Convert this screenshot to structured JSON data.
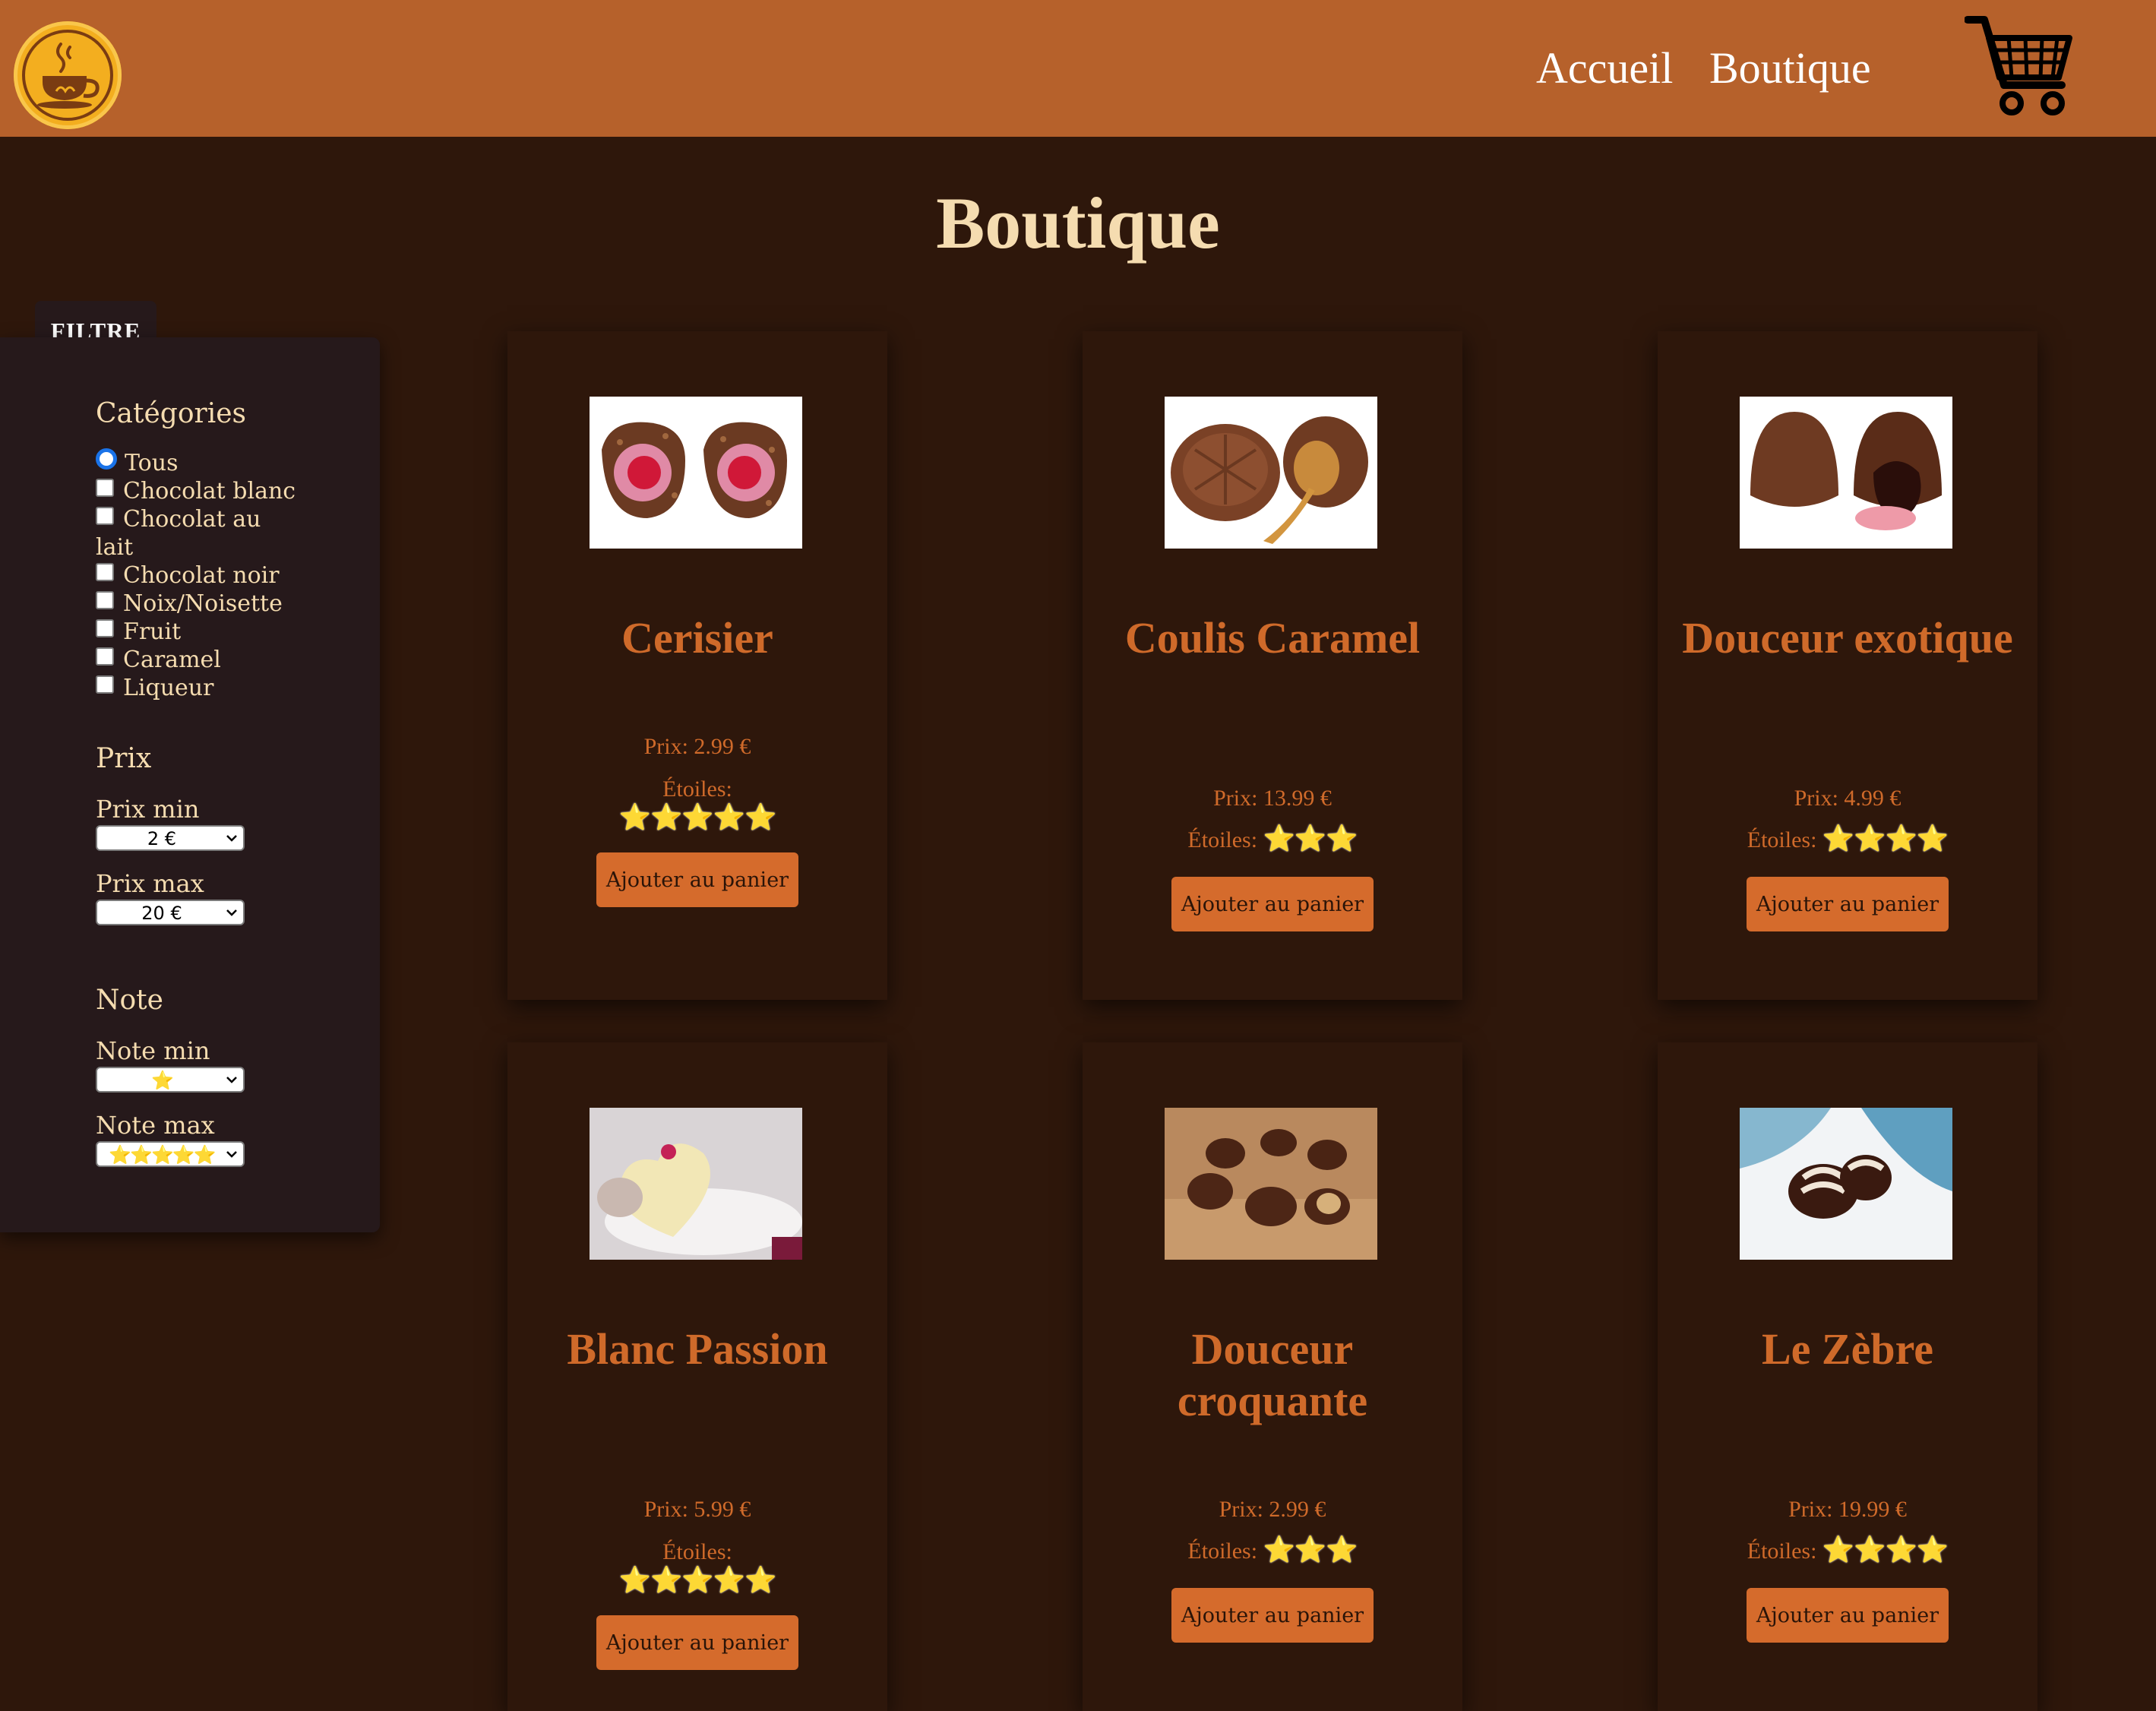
{
  "colors": {
    "header_bg": "#b6612b",
    "page_bg": "#2e170b",
    "filter_bg": "#26191b",
    "title": "#f5dcb0",
    "product_accent": "#cf6a2a",
    "button_bg": "#d56b2c",
    "star": "#f6c51d"
  },
  "header": {
    "logo_icon": "coffee-cup-logo",
    "nav": {
      "home": "Accueil",
      "shop": "Boutique"
    },
    "cart_icon": "shopping-cart-icon"
  },
  "page": {
    "title": "Boutique"
  },
  "filter": {
    "tab_label": "FILTRE",
    "categories": {
      "heading": "Catégories",
      "items": [
        {
          "label": "Tous",
          "type": "radio",
          "checked": true
        },
        {
          "label": "Chocolat blanc",
          "type": "checkbox",
          "checked": false
        },
        {
          "label": "Chocolat au lait",
          "type": "checkbox",
          "checked": false
        },
        {
          "label": "Chocolat noir",
          "type": "checkbox",
          "checked": false
        },
        {
          "label": "Noix/Noisette",
          "type": "checkbox",
          "checked": false
        },
        {
          "label": "Fruit",
          "type": "checkbox",
          "checked": false
        },
        {
          "label": "Caramel",
          "type": "checkbox",
          "checked": false
        },
        {
          "label": "Liqueur",
          "type": "checkbox",
          "checked": false
        }
      ]
    },
    "price": {
      "heading": "Prix",
      "min_label": "Prix min",
      "min_value": "2 €",
      "max_label": "Prix max",
      "max_value": "20 €"
    },
    "rating": {
      "heading": "Note",
      "min_label": "Note min",
      "min_value": "⭐",
      "max_label": "Note max",
      "max_value": "⭐⭐⭐⭐⭐"
    }
  },
  "products": [
    {
      "name": "Cerisier",
      "price": "Prix: 2.99 €",
      "stars_label": "Étoiles:",
      "stars": "⭐⭐⭐⭐⭐",
      "rating": 5,
      "button": "Ajouter au panier",
      "image_icon": "cherry-chocolate-image"
    },
    {
      "name": "Coulis Caramel",
      "price": "Prix: 13.99 €",
      "stars_label": "Étoiles:",
      "stars": "⭐⭐⭐",
      "rating": 3,
      "button": "Ajouter au panier",
      "image_icon": "caramel-chocolate-image"
    },
    {
      "name": "Douceur exotique",
      "price": "Prix: 4.99 €",
      "stars_label": "Étoiles:",
      "stars": "⭐⭐⭐⭐",
      "rating": 4,
      "button": "Ajouter au panier",
      "image_icon": "exotic-chocolate-image"
    },
    {
      "name": "Blanc Passion",
      "price": "Prix: 5.99 €",
      "stars_label": "Étoiles:",
      "stars": "⭐⭐⭐⭐⭐",
      "rating": 5,
      "button": "Ajouter au panier",
      "image_icon": "white-chocolate-image"
    },
    {
      "name": "Douceur croquante",
      "price": "Prix: 2.99 €",
      "stars_label": "Étoiles:",
      "stars": "⭐⭐⭐",
      "rating": 3,
      "button": "Ajouter au panier",
      "image_icon": "crunchy-chocolate-image"
    },
    {
      "name": "Le Zèbre",
      "price": "Prix: 19.99 €",
      "stars_label": "Étoiles:",
      "stars": "⭐⭐⭐⭐",
      "rating": 4,
      "button": "Ajouter au panier",
      "image_icon": "zebra-chocolate-image"
    }
  ]
}
